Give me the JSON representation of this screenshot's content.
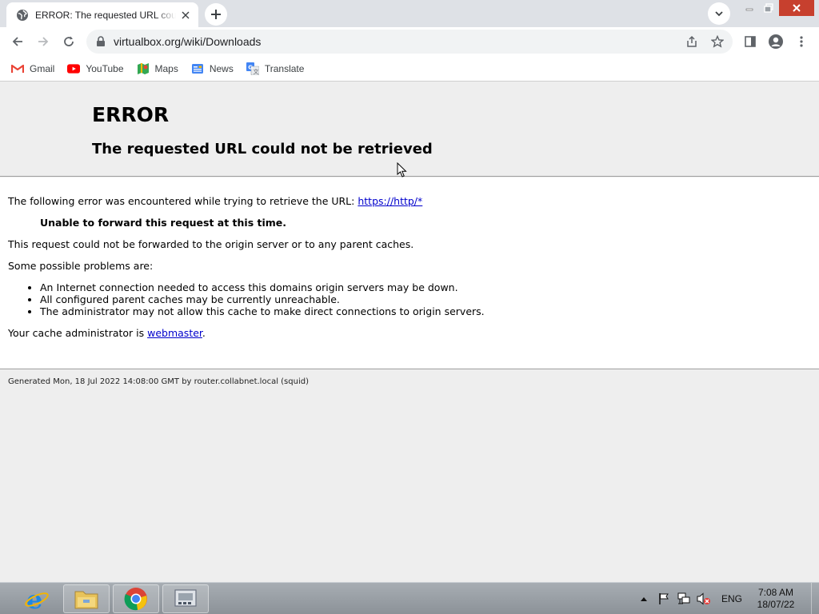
{
  "browser": {
    "tab": {
      "title": "ERROR: The requested URL could not be retrieved",
      "favicon": "globe-icon"
    },
    "address_bar": {
      "url": "virtualbox.org/wiki/Downloads"
    },
    "bookmarks": [
      {
        "label": "Gmail",
        "icon": "gmail-icon"
      },
      {
        "label": "YouTube",
        "icon": "youtube-icon"
      },
      {
        "label": "Maps",
        "icon": "maps-icon"
      },
      {
        "label": "News",
        "icon": "news-icon"
      },
      {
        "label": "Translate",
        "icon": "translate-icon"
      }
    ]
  },
  "page": {
    "heading": "ERROR",
    "subheading": "The requested URL could not be retrieved",
    "intro_text": "The following error was encountered while trying to retrieve the URL: ",
    "intro_link": "https://http/*",
    "error_detail": "Unable to forward this request at this time.",
    "explanation": "This request could not be forwarded to the origin server or to any parent caches.",
    "problems_label": "Some possible problems are:",
    "problems": [
      "An Internet connection needed to access this domains origin servers may be down.",
      "All configured parent caches may be currently unreachable.",
      "The administrator may not allow this cache to make direct connections to origin servers."
    ],
    "admin_text": "Your cache administrator is ",
    "admin_link": "webmaster",
    "admin_suffix": ".",
    "footer": "Generated Mon, 18 Jul 2022 14:08:00 GMT by router.collabnet.local (squid)"
  },
  "taskbar": {
    "apps": [
      "internet-explorer-icon",
      "file-explorer-icon",
      "chrome-icon",
      "network-app-icon"
    ],
    "language": "ENG",
    "time": "7:08 AM",
    "date": "18/07/22"
  },
  "colors": {
    "link": "#0000cc",
    "tabstrip": "#dee1e6",
    "close_button": "#c7402e"
  }
}
